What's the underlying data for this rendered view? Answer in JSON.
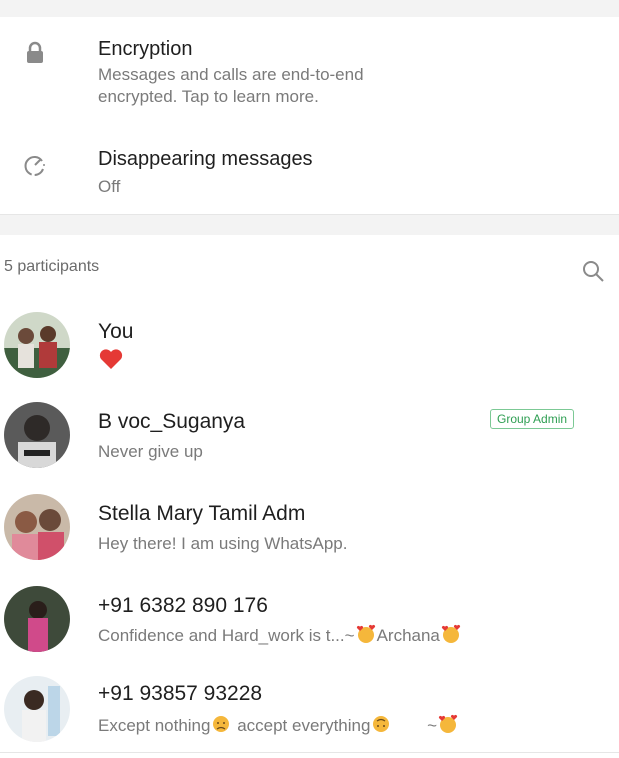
{
  "settings": {
    "encryption": {
      "title": "Encryption",
      "desc_line1": "Messages and calls are end-to-end",
      "desc_line2": "encrypted. Tap to learn more.",
      "icon": "lock-icon"
    },
    "disappearing": {
      "title": "Disappearing messages",
      "value": "Off",
      "icon": "timer-icon"
    }
  },
  "participants": {
    "count_label": "5 participants",
    "search_icon": "search-icon",
    "admin_badge": "Group Admin",
    "items": [
      {
        "name": "You",
        "status_icon": "heart-icon"
      },
      {
        "name": "B voc_Suganya",
        "status": "Never give up",
        "is_admin": true
      },
      {
        "name": "Stella Mary Tamil Adm",
        "status": "Hey there! I am using WhatsApp."
      },
      {
        "name": "+91 6382 890 176",
        "status_text": "Confidence and Hard_work is t...~",
        "status_suffix": "Archana"
      },
      {
        "name": "+91 93857 93228",
        "status_part1": "Except nothing",
        "status_part2": " accept everything",
        "status_tail": "~"
      }
    ]
  },
  "colors": {
    "admin_green": "#2e9e52",
    "heart_red": "#e53935"
  }
}
